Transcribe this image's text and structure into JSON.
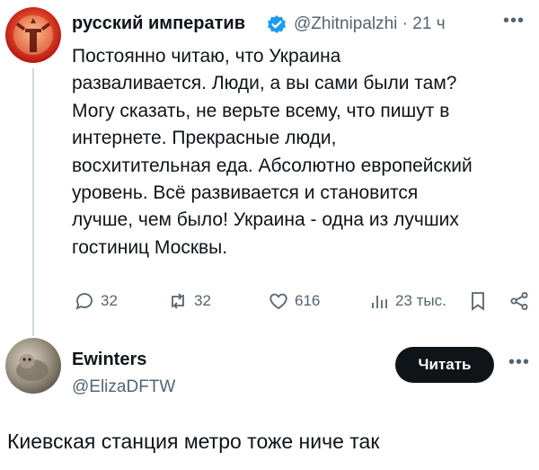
{
  "main_tweet": {
    "author_name": "русский императив",
    "handle": "@Zhitnipalzhi",
    "separator": "·",
    "time": "21 ч",
    "text": "Постоянно читаю, что Украина\nразваливается. Люди, а вы сами были там?\nМогу сказать, не верьте всему, что пишут в\nинтернете. Прекрасные люди,\nвосхитительная еда. Абсолютно европейский\nуровень. Всё развивается и становится\nлучше, чем было! Украина - одна из лучших\nгостиниц Москвы.",
    "more_label": "•••",
    "icons": {
      "verified": "verified-badge-icon",
      "reply": "reply-icon",
      "retweet": "retweet-icon",
      "like": "like-icon",
      "views": "views-icon",
      "bookmark": "bookmark-icon",
      "share": "share-icon"
    },
    "stats": {
      "replies": "32",
      "retweets": "32",
      "likes": "616",
      "views": "23 тыс."
    }
  },
  "reply_user": {
    "name": "Ewinters",
    "handle": "@ElizaDFTW",
    "follow_label": "Читать",
    "more_label": "•••",
    "text": "Киевская станция метро тоже ниче так"
  },
  "colors": {
    "text": "#0f1419",
    "secondary": "#536471",
    "verified": "#1d9bf0",
    "follow_bg": "#0f1419"
  }
}
